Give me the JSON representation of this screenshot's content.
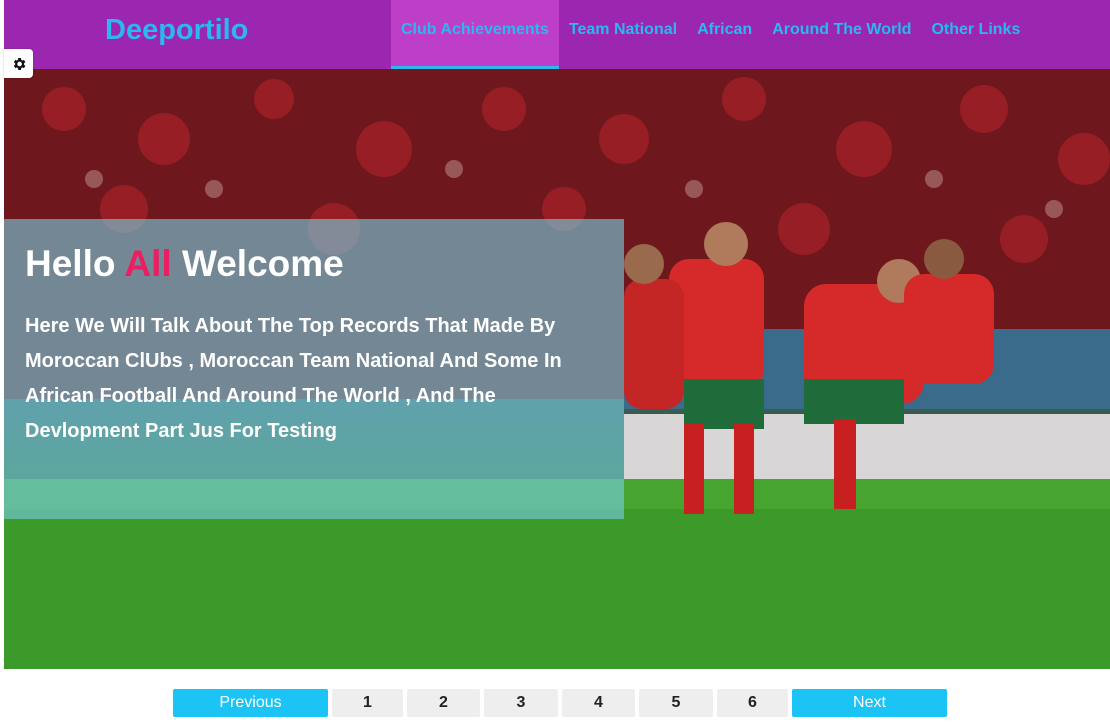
{
  "header": {
    "logo": "Deeportilo",
    "nav": [
      {
        "label": "Club Achievements",
        "active": true
      },
      {
        "label": "Team National",
        "active": false
      },
      {
        "label": "African",
        "active": false
      },
      {
        "label": "Around The World",
        "active": false
      },
      {
        "label": "Other Links",
        "active": false
      }
    ]
  },
  "settings": {
    "icon": "gear-icon"
  },
  "hero": {
    "title_part1": "Hello",
    "title_accent": "All",
    "title_part2": "Welcome",
    "text": "Here We Will Talk About The Top Records That Made By Moroccan ClUbs , Moroccan Team National And Some In African Football And Around The World , And The Devlopment Part Jus For Testing",
    "accent_color": "#e91e63",
    "image": "photo of football players in red and green kits celebrating on the pitch"
  },
  "pagination": {
    "previous": "Previous",
    "pages": [
      "1",
      "2",
      "3",
      "4",
      "5",
      "6"
    ],
    "next": "Next"
  },
  "colors": {
    "header_bg": "#9b27b0",
    "nav_text": "#2bb8f0",
    "button_bg": "#1cc3f5"
  }
}
